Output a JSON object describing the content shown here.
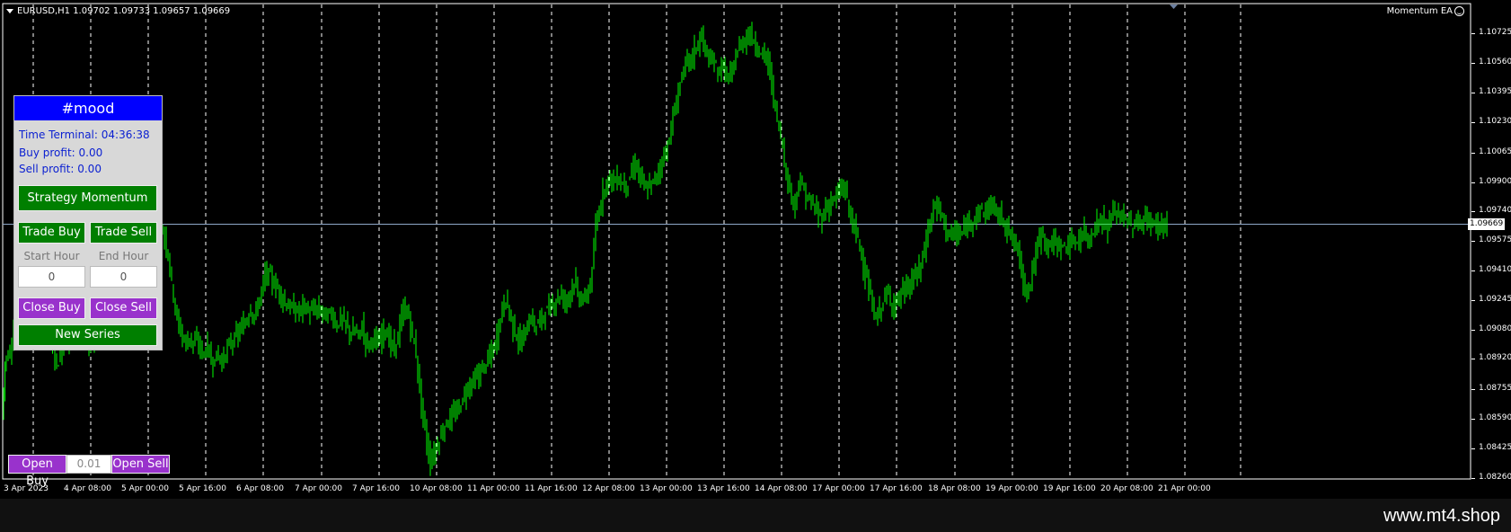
{
  "header": {
    "symbol_info": "EURUSD,H1  1.09702 1.09733 1.09657 1.09669",
    "ea_name": "Momentum EA"
  },
  "price_axis": {
    "ticks": [
      "1.10725",
      "1.10560",
      "1.10395",
      "1.10230",
      "1.10065",
      "1.09900",
      "1.09740",
      "1.09575",
      "1.09410",
      "1.09245",
      "1.09080",
      "1.08920",
      "1.08755",
      "1.08590",
      "1.08425",
      "1.08260"
    ],
    "current_price": "1.09669"
  },
  "time_axis": {
    "ticks": [
      "3 Apr 2023",
      "4 Apr 08:00",
      "5 Apr 00:00",
      "5 Apr 16:00",
      "6 Apr 08:00",
      "7 Apr 00:00",
      "7 Apr 16:00",
      "10 Apr 08:00",
      "11 Apr 00:00",
      "11 Apr 16:00",
      "12 Apr 08:00",
      "13 Apr 00:00",
      "13 Apr 16:00",
      "14 Apr 08:00",
      "17 Apr 00:00",
      "17 Apr 16:00",
      "18 Apr 08:00",
      "19 Apr 00:00",
      "19 Apr 16:00",
      "20 Apr 08:00",
      "21 Apr 00:00"
    ]
  },
  "colors": {
    "background": "#000000",
    "candle": "#00ff00",
    "grid": "#ffffff",
    "bid_line": "#8fa8c8",
    "panel_title": "#0000ff",
    "green_button": "#007f00",
    "purple_button": "#9932cc"
  },
  "panel": {
    "title": "#mood",
    "time_terminal": "Time Terminal: 04:36:38",
    "buy_profit": "Buy profit: 0.00",
    "sell_profit": "Sell profit: 0.00",
    "strategy_button": "Strategy Momentum",
    "trade_buy": "Trade Buy",
    "trade_sell": "Trade Sell",
    "start_hour_label": "Start Hour",
    "end_hour_label": "End Hour",
    "start_hour_value": "0",
    "end_hour_value": "0",
    "close_buy": "Close Buy",
    "close_sell": "Close Sell",
    "new_series": "New Series"
  },
  "quick_trade": {
    "open_buy": "Open Buy",
    "lot_value": "0.01",
    "open_sell": "Open Sell"
  },
  "watermark": "www.mt4.shop",
  "price_path": [
    [
      3,
      1.086
    ],
    [
      6,
      1.089
    ],
    [
      10,
      1.0895
    ],
    [
      14,
      1.09
    ],
    [
      18,
      1.0915
    ],
    [
      22,
      1.0905
    ],
    [
      26,
      1.0908
    ],
    [
      30,
      1.0912
    ],
    [
      35,
      1.092
    ],
    [
      40,
      1.0925
    ],
    [
      45,
      1.0918
    ],
    [
      50,
      1.0915
    ],
    [
      55,
      1.0905
    ],
    [
      60,
      1.0895
    ],
    [
      64,
      1.089
    ],
    [
      68,
      1.0892
    ],
    [
      72,
      1.0905
    ],
    [
      76,
      1.09
    ],
    [
      80,
      1.0915
    ],
    [
      84,
      1.093
    ],
    [
      88,
      1.0945
    ],
    [
      92,
      1.0935
    ],
    [
      96,
      1.091
    ],
    [
      100,
      1.09
    ],
    [
      104,
      1.0905
    ],
    [
      108,
      1.0915
    ],
    [
      112,
      1.0925
    ],
    [
      116,
      1.0935
    ],
    [
      120,
      1.0945
    ],
    [
      124,
      1.095
    ],
    [
      128,
      1.094
    ],
    [
      132,
      1.0955
    ],
    [
      136,
      1.096
    ],
    [
      140,
      1.0948
    ],
    [
      144,
      1.095
    ],
    [
      148,
      1.0962
    ],
    [
      152,
      1.0958
    ],
    [
      156,
      1.0955
    ],
    [
      160,
      1.095
    ],
    [
      164,
      1.096
    ],
    [
      168,
      1.0952
    ],
    [
      172,
      1.0945
    ],
    [
      176,
      1.0958
    ],
    [
      180,
      1.0965
    ],
    [
      184,
      1.096
    ],
    [
      188,
      1.095
    ],
    [
      192,
      1.0935
    ],
    [
      196,
      1.092
    ],
    [
      200,
      1.091
    ],
    [
      204,
      1.0905
    ],
    [
      208,
      1.09
    ],
    [
      212,
      1.0905
    ],
    [
      216,
      1.09
    ],
    [
      220,
      1.0902
    ],
    [
      224,
      1.0898
    ],
    [
      228,
      1.0895
    ],
    [
      232,
      1.09
    ],
    [
      236,
      1.089
    ],
    [
      240,
      1.0892
    ],
    [
      244,
      1.0895
    ],
    [
      248,
      1.089
    ],
    [
      252,
      1.0895
    ],
    [
      256,
      1.09
    ],
    [
      260,
      1.0902
    ],
    [
      264,
      1.0905
    ],
    [
      268,
      1.0908
    ],
    [
      272,
      1.091
    ],
    [
      276,
      1.0915
    ],
    [
      280,
      1.092
    ],
    [
      284,
      1.0915
    ],
    [
      288,
      1.0922
    ],
    [
      292,
      1.093
    ],
    [
      296,
      1.0938
    ],
    [
      300,
      1.094
    ],
    [
      304,
      1.0935
    ],
    [
      308,
      1.0932
    ],
    [
      312,
      1.093
    ],
    [
      316,
      1.0925
    ],
    [
      320,
      1.0922
    ],
    [
      324,
      1.092
    ],
    [
      328,
      1.092
    ],
    [
      332,
      1.0918
    ],
    [
      336,
      1.092
    ],
    [
      340,
      1.0922
    ],
    [
      344,
      1.0918
    ],
    [
      348,
      1.0918
    ],
    [
      352,
      1.092
    ],
    [
      356,
      1.0918
    ],
    [
      360,
      1.0919
    ],
    [
      364,
      1.0915
    ],
    [
      368,
      1.0918
    ],
    [
      372,
      1.0915
    ],
    [
      376,
      1.091
    ],
    [
      380,
      1.0915
    ],
    [
      384,
      1.0912
    ],
    [
      388,
      1.091
    ],
    [
      392,
      1.0905
    ],
    [
      396,
      1.0908
    ],
    [
      400,
      1.0905
    ],
    [
      404,
      1.091
    ],
    [
      408,
      1.0902
    ],
    [
      412,
      1.09
    ],
    [
      416,
      1.0905
    ],
    [
      420,
      1.09
    ],
    [
      424,
      1.0902
    ],
    [
      428,
      1.091
    ],
    [
      432,
      1.0905
    ],
    [
      436,
      1.09
    ],
    [
      440,
      1.0898
    ],
    [
      444,
      1.0905
    ],
    [
      448,
      1.0915
    ],
    [
      452,
      1.092
    ],
    [
      456,
      1.0915
    ],
    [
      460,
      1.0905
    ],
    [
      464,
      1.0895
    ],
    [
      468,
      1.0875
    ],
    [
      472,
      1.086
    ],
    [
      476,
      1.0845
    ],
    [
      480,
      1.0835
    ],
    [
      484,
      1.084
    ],
    [
      488,
      1.0845
    ],
    [
      492,
      1.085
    ],
    [
      496,
      1.0855
    ],
    [
      500,
      1.0858
    ],
    [
      504,
      1.086
    ],
    [
      508,
      1.0862
    ],
    [
      512,
      1.0865
    ],
    [
      516,
      1.087
    ],
    [
      520,
      1.0875
    ],
    [
      524,
      1.0878
    ],
    [
      528,
      1.088
    ],
    [
      532,
      1.0882
    ],
    [
      536,
      1.0885
    ],
    [
      540,
      1.0888
    ],
    [
      544,
      1.0892
    ],
    [
      548,
      1.0895
    ],
    [
      552,
      1.09
    ],
    [
      556,
      1.091
    ],
    [
      560,
      1.092
    ],
    [
      564,
      1.0925
    ],
    [
      568,
      1.0918
    ],
    [
      572,
      1.091
    ],
    [
      576,
      1.0905
    ],
    [
      580,
      1.09
    ],
    [
      584,
      1.0905
    ],
    [
      588,
      1.091
    ],
    [
      592,
      1.0915
    ],
    [
      596,
      1.091
    ],
    [
      600,
      1.0912
    ],
    [
      604,
      1.0915
    ],
    [
      608,
      1.0918
    ],
    [
      612,
      1.092
    ],
    [
      616,
      1.0922
    ],
    [
      620,
      1.0925
    ],
    [
      624,
      1.0928
    ],
    [
      628,
      1.0925
    ],
    [
      632,
      1.0925
    ],
    [
      636,
      1.093
    ],
    [
      640,
      1.0935
    ],
    [
      644,
      1.0928
    ],
    [
      648,
      1.0925
    ],
    [
      652,
      1.0925
    ],
    [
      656,
      1.093
    ],
    [
      660,
      1.094
    ],
    [
      664,
      1.0965
    ],
    [
      668,
      1.0975
    ],
    [
      672,
      1.0985
    ],
    [
      676,
      1.099
    ],
    [
      680,
      1.0993
    ],
    [
      684,
      1.099
    ],
    [
      688,
      1.0992
    ],
    [
      692,
      1.099
    ],
    [
      696,
      1.0988
    ],
    [
      700,
      1.099
    ],
    [
      704,
      1.0995
    ],
    [
      708,
      1.1
    ],
    [
      712,
      1.0995
    ],
    [
      716,
      1.099
    ],
    [
      720,
      1.0985
    ],
    [
      724,
      1.0988
    ],
    [
      728,
      1.099
    ],
    [
      732,
      1.0995
    ],
    [
      736,
      1.0998
    ],
    [
      740,
      1.1005
    ],
    [
      744,
      1.101
    ],
    [
      748,
      1.102
    ],
    [
      752,
      1.103
    ],
    [
      756,
      1.104
    ],
    [
      760,
      1.105
    ],
    [
      764,
      1.1055
    ],
    [
      768,
      1.1058
    ],
    [
      772,
      1.106
    ],
    [
      776,
      1.1065
    ],
    [
      780,
      1.107
    ],
    [
      784,
      1.1068
    ],
    [
      788,
      1.106
    ],
    [
      792,
      1.1055
    ],
    [
      796,
      1.1058
    ],
    [
      800,
      1.105
    ],
    [
      804,
      1.1055
    ],
    [
      808,
      1.105
    ],
    [
      812,
      1.1048
    ],
    [
      816,
      1.105
    ],
    [
      820,
      1.106
    ],
    [
      824,
      1.1065
    ],
    [
      828,
      1.1068
    ],
    [
      832,
      1.107
    ],
    [
      836,
      1.1072
    ],
    [
      840,
      1.1068
    ],
    [
      844,
      1.1065
    ],
    [
      848,
      1.106
    ],
    [
      852,
      1.1062
    ],
    [
      856,
      1.1055
    ],
    [
      860,
      1.1045
    ],
    [
      864,
      1.103
    ],
    [
      868,
      1.102
    ],
    [
      872,
      1.101
    ],
    [
      876,
      1.0995
    ],
    [
      880,
      1.0985
    ],
    [
      884,
      1.0978
    ],
    [
      888,
      1.0985
    ],
    [
      892,
      1.099
    ],
    [
      896,
      1.0985
    ],
    [
      900,
      1.098
    ],
    [
      904,
      1.0978
    ],
    [
      908,
      1.0975
    ],
    [
      912,
      1.0972
    ],
    [
      916,
      1.097
    ],
    [
      920,
      1.0975
    ],
    [
      924,
      1.0978
    ],
    [
      928,
      1.098
    ],
    [
      932,
      1.0982
    ],
    [
      936,
      1.0985
    ],
    [
      940,
      1.0988
    ],
    [
      944,
      1.098
    ],
    [
      948,
      1.097
    ],
    [
      952,
      1.0965
    ],
    [
      956,
      1.0958
    ],
    [
      960,
      1.095
    ],
    [
      964,
      1.094
    ],
    [
      968,
      1.093
    ],
    [
      972,
      1.092
    ],
    [
      976,
      1.0915
    ],
    [
      980,
      1.0918
    ],
    [
      984,
      1.0925
    ],
    [
      988,
      1.0928
    ],
    [
      992,
      1.0925
    ],
    [
      996,
      1.0922
    ],
    [
      1000,
      1.0925
    ],
    [
      1004,
      1.0928
    ],
    [
      1008,
      1.093
    ],
    [
      1012,
      1.0932
    ],
    [
      1016,
      1.0935
    ],
    [
      1020,
      1.0938
    ],
    [
      1024,
      1.0942
    ],
    [
      1028,
      1.0948
    ],
    [
      1032,
      1.0958
    ],
    [
      1036,
      1.0968
    ],
    [
      1040,
      1.0975
    ],
    [
      1044,
      1.0978
    ],
    [
      1048,
      1.0972
    ],
    [
      1052,
      1.0968
    ],
    [
      1056,
      1.0962
    ],
    [
      1060,
      1.096
    ],
    [
      1064,
      1.0962
    ],
    [
      1068,
      1.096
    ],
    [
      1072,
      1.0962
    ],
    [
      1076,
      1.0965
    ],
    [
      1080,
      1.0968
    ],
    [
      1084,
      1.097
    ],
    [
      1088,
      1.0972
    ],
    [
      1092,
      1.0975
    ],
    [
      1096,
      1.0972
    ],
    [
      1100,
      1.0975
    ],
    [
      1104,
      1.0978
    ],
    [
      1108,
      1.0975
    ],
    [
      1112,
      1.0972
    ],
    [
      1116,
      1.097
    ],
    [
      1120,
      1.0968
    ],
    [
      1124,
      1.0962
    ],
    [
      1128,
      1.0958
    ],
    [
      1132,
      1.0955
    ],
    [
      1136,
      1.0948
    ],
    [
      1140,
      1.0935
    ],
    [
      1144,
      1.093
    ],
    [
      1148,
      1.0935
    ],
    [
      1152,
      1.0945
    ],
    [
      1156,
      1.0955
    ],
    [
      1160,
      1.0962
    ],
    [
      1164,
      1.0958
    ],
    [
      1168,
      1.0955
    ],
    [
      1172,
      1.0955
    ],
    [
      1176,
      1.0958
    ],
    [
      1180,
      1.0955
    ],
    [
      1184,
      1.0953
    ],
    [
      1188,
      1.0955
    ],
    [
      1192,
      1.0956
    ],
    [
      1196,
      1.0955
    ],
    [
      1200,
      1.0958
    ],
    [
      1204,
      1.096
    ],
    [
      1208,
      1.0962
    ],
    [
      1212,
      1.0958
    ],
    [
      1216,
      1.0962
    ],
    [
      1220,
      1.0965
    ],
    [
      1224,
      1.0968
    ],
    [
      1228,
      1.097
    ],
    [
      1232,
      1.0965
    ],
    [
      1236,
      1.0968
    ],
    [
      1240,
      1.0972
    ],
    [
      1244,
      1.0975
    ],
    [
      1248,
      1.097
    ],
    [
      1252,
      1.0972
    ],
    [
      1256,
      1.0968
    ],
    [
      1260,
      1.0965
    ],
    [
      1264,
      1.0968
    ],
    [
      1268,
      1.0966
    ],
    [
      1272,
      1.0968
    ],
    [
      1276,
      1.097
    ],
    [
      1280,
      1.0968
    ],
    [
      1284,
      1.0966
    ],
    [
      1288,
      1.0967
    ],
    [
      1292,
      1.0966
    ],
    [
      1296,
      1.0967
    ],
    [
      1300,
      1.0967
    ]
  ]
}
